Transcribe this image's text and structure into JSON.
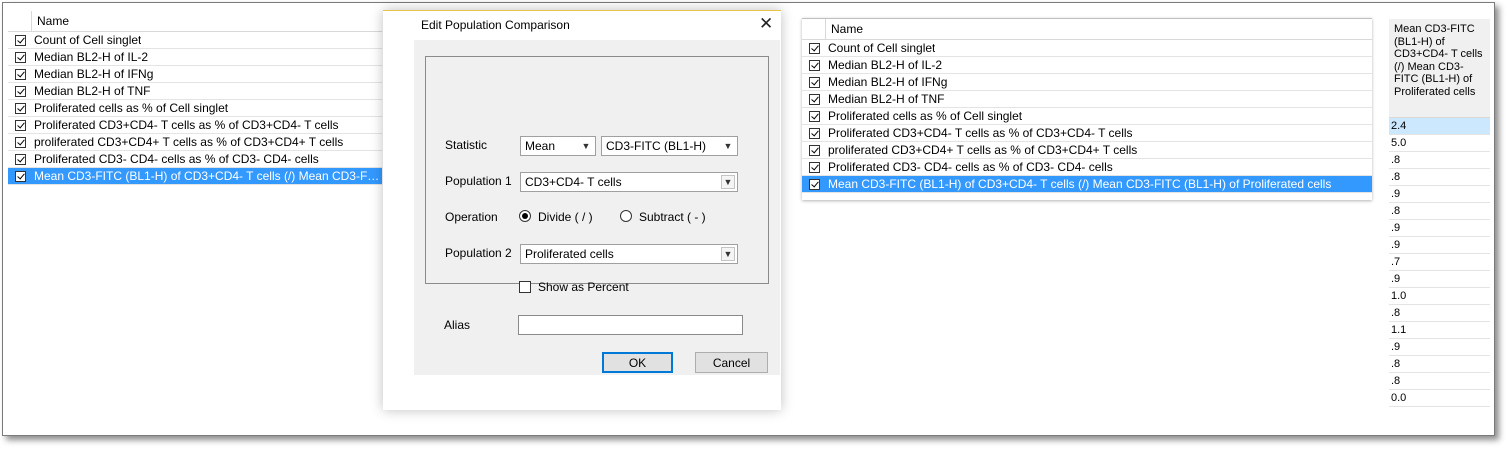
{
  "left_list": {
    "header": "Name",
    "rows": [
      {
        "label": "Count of Cell singlet",
        "checked": true
      },
      {
        "label": "Median BL2-H of IL-2",
        "checked": true
      },
      {
        "label": "Median BL2-H of IFNg",
        "checked": true
      },
      {
        "label": "Median BL2-H of TNF",
        "checked": true
      },
      {
        "label": "Proliferated cells as % of Cell singlet",
        "checked": true
      },
      {
        "label": "Proliferated CD3+CD4- T cells as % of CD3+CD4- T cells",
        "checked": true
      },
      {
        "label": "proliferated CD3+CD4+ T cells as % of CD3+CD4+ T cells",
        "checked": true
      },
      {
        "label": "Proliferated CD3- CD4- cells as % of CD3- CD4- cells",
        "checked": true
      },
      {
        "label": "Mean CD3-FITC (BL1-H) of CD3+CD4- T cells (/) Mean CD3-FITC (...",
        "checked": true,
        "selected": true
      }
    ]
  },
  "dialog": {
    "title": "Edit Population Comparison",
    "close": "✕",
    "statistic_label": "Statistic",
    "statistic_value": "Mean",
    "channel_value": "CD3-FITC (BL1-H)",
    "population1_label": "Population 1",
    "population1_value": "CD3+CD4- T cells",
    "operation_label": "Operation",
    "divide_label": "Divide ( / )",
    "subtract_label": "Subtract ( - )",
    "population2_label": "Population 2",
    "population2_value": "Proliferated cells",
    "show_percent_label": "Show as Percent",
    "alias_label": "Alias",
    "alias_value": "",
    "ok_label": "OK",
    "cancel_label": "Cancel"
  },
  "right_list": {
    "header": "Name",
    "rows": [
      {
        "label": "Count of Cell singlet",
        "checked": true
      },
      {
        "label": "Median BL2-H of IL-2",
        "checked": true
      },
      {
        "label": "Median BL2-H of IFNg",
        "checked": true
      },
      {
        "label": "Median BL2-H of TNF",
        "checked": true
      },
      {
        "label": "Proliferated cells as % of Cell singlet",
        "checked": true
      },
      {
        "label": "Proliferated CD3+CD4- T cells as % of CD3+CD4- T cells",
        "checked": true
      },
      {
        "label": "proliferated CD3+CD4+ T cells as % of CD3+CD4+ T cells",
        "checked": true
      },
      {
        "label": "Proliferated CD3- CD4- cells as % of CD3- CD4- cells",
        "checked": true
      },
      {
        "label": "Mean CD3-FITC (BL1-H) of CD3+CD4- T cells (/) Mean CD3-FITC (BL1-H) of Proliferated cells",
        "checked": true,
        "selected": true
      }
    ]
  },
  "value_column": {
    "header": "Mean CD3-FITC (BL1-H) of CD3+CD4- T cells (/) Mean CD3-FITC (BL1-H) of Proliferated cells",
    "values": [
      "2.4",
      "5.0",
      ".8",
      ".8",
      ".9",
      ".8",
      ".9",
      ".9",
      ".7",
      ".9",
      "1.0",
      ".8",
      "1.1",
      ".9",
      ".8",
      ".8",
      "0.0"
    ]
  },
  "colors": {
    "selection": "#3399ff",
    "value_selection": "#cce8ff",
    "dialog_body": "#f0f0f0",
    "primary_border": "#0078d7"
  }
}
